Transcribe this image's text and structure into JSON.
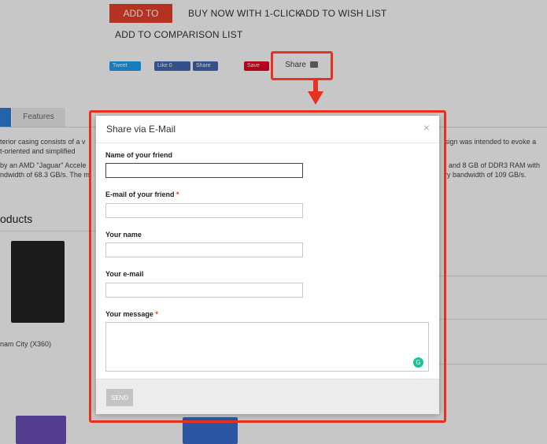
{
  "product_actions": {
    "add_to_cart": "ADD TO CART",
    "buy_now": "BUY NOW WITH 1-CLICK",
    "add_to_wishlist": "ADD TO WISH LIST",
    "add_to_comparison": "ADD TO COMPARISON LIST"
  },
  "social": {
    "tweet": "Tweet",
    "like": "Like 0",
    "share_fb": "Share",
    "save": "Save",
    "share_email": "Share"
  },
  "tabs": [
    {
      "label": ""
    },
    {
      "label": "Features"
    }
  ],
  "description": {
    "line1_left": "terior casing consists of a v",
    "line1_right": "sign was intended to evoke a",
    "line2_left": "t-oriented and simplified",
    "line3_left": "by an AMD \"Jaguar\" Accele",
    "line3_right": "; and 8 GB of DDR3 RAM with",
    "line4_left": "ndwidth of 68.3 GB/s. The m",
    "line4_right": "ry bandwidth of 109 GB/s."
  },
  "related": {
    "title": "oducts",
    "caption1": "nam City (X360)"
  },
  "modal": {
    "title": "Share via E-Mail",
    "close": "×",
    "fields": [
      {
        "label": "Name of your friend",
        "required": false,
        "value": ""
      },
      {
        "label": "E-mail of your friend",
        "required": true,
        "value": ""
      },
      {
        "label": "Your name",
        "required": false,
        "value": ""
      },
      {
        "label": "Your e-mail",
        "required": false,
        "value": ""
      }
    ],
    "message_label": "Your message",
    "message_required": true,
    "required_mark": "*",
    "send": "SEND"
  },
  "colors": {
    "annotation": "#e8311f",
    "cart": "#e8412c",
    "tab_active": "#2f7fd7"
  }
}
